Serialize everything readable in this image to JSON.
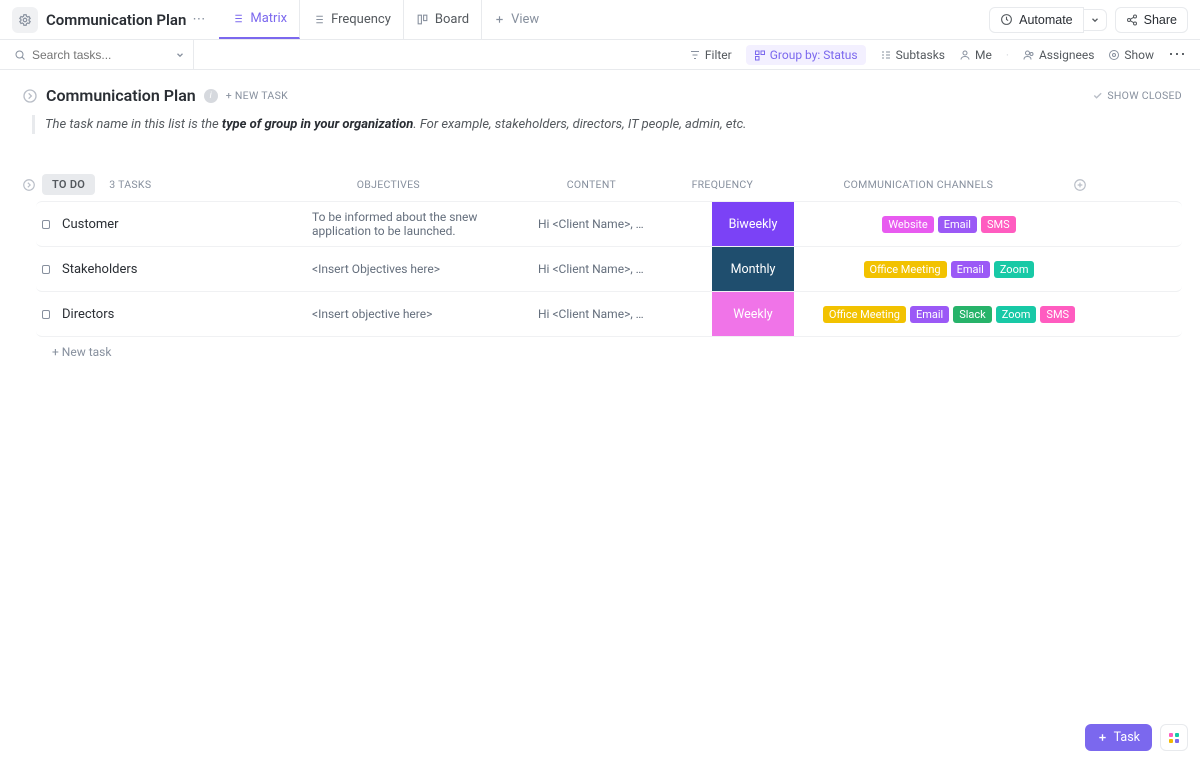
{
  "header": {
    "title": "Communication Plan",
    "automate": "Automate",
    "share": "Share",
    "views": [
      {
        "label": "Matrix",
        "icon": "list",
        "active": true
      },
      {
        "label": "Frequency",
        "icon": "list",
        "active": false
      },
      {
        "label": "Board",
        "icon": "board",
        "active": false
      }
    ],
    "add_view": "View"
  },
  "toolbar": {
    "search_placeholder": "Search tasks...",
    "filter": "Filter",
    "group_by": "Group by: Status",
    "subtasks": "Subtasks",
    "me": "Me",
    "assignees": "Assignees",
    "show": "Show"
  },
  "list": {
    "title": "Communication Plan",
    "new_task": "+ NEW TASK",
    "show_closed": "SHOW CLOSED",
    "description_prefix": "The task name in this list is the ",
    "description_bold": "type of group in your organization",
    "description_suffix": ". For example, stakeholders, directors, IT people, admin, etc."
  },
  "group": {
    "status_label": "TO DO",
    "count": "3 TASKS",
    "columns": {
      "objectives": "OBJECTIVES",
      "content": "CONTENT",
      "frequency": "FREQUENCY",
      "channels": "COMMUNICATION CHANNELS"
    }
  },
  "tasks": [
    {
      "name": "Customer",
      "objectives": "To be informed about the snew application to be launched.",
      "content": "Hi <Client Name>, …",
      "frequency": {
        "label": "Biweekly",
        "color": "#7b42f6"
      },
      "channels": [
        {
          "label": "Website",
          "color": "#e85bf0"
        },
        {
          "label": "Email",
          "color": "#9b59f6"
        },
        {
          "label": "SMS",
          "color": "#ff5cc0"
        }
      ]
    },
    {
      "name": "Stakeholders",
      "objectives": "<Insert Objectives here>",
      "content": "Hi <Client Name>, …",
      "frequency": {
        "label": "Monthly",
        "color": "#1f4e6e"
      },
      "channels": [
        {
          "label": "Office Meeting",
          "color": "#f2c200"
        },
        {
          "label": "Email",
          "color": "#9b59f6"
        },
        {
          "label": "Zoom",
          "color": "#18c9a6"
        }
      ]
    },
    {
      "name": "Directors",
      "objectives": "<Insert objective here>",
      "content": "Hi <Client Name>, …",
      "frequency": {
        "label": "Weekly",
        "color": "#f074e8"
      },
      "channels": [
        {
          "label": "Office Meeting",
          "color": "#f2c200"
        },
        {
          "label": "Email",
          "color": "#9b59f6"
        },
        {
          "label": "Slack",
          "color": "#27b36a"
        },
        {
          "label": "Zoom",
          "color": "#18c9a6"
        },
        {
          "label": "SMS",
          "color": "#ff5cc0"
        }
      ]
    }
  ],
  "footer": {
    "new_task_row": "+ New task",
    "fab_task": "Task"
  }
}
